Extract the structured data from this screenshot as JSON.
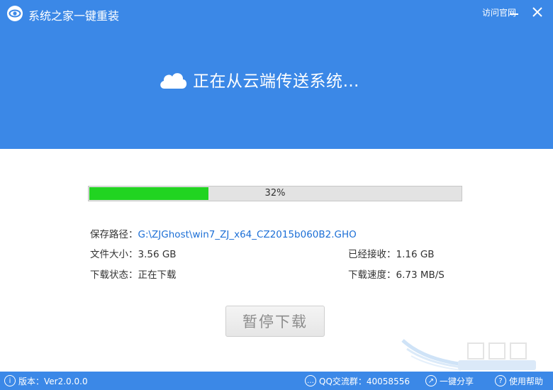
{
  "title_bar": {
    "app_title": "系统之家一键重装",
    "visit_link": "访问官网",
    "icons": [
      "app-logo-icon",
      "minimize-icon",
      "close-icon"
    ]
  },
  "status": {
    "text": "正在从云端传送系统…",
    "icon": "cloud-icon"
  },
  "progress": {
    "percent_text": "32%",
    "fraction": 0.32,
    "fill_color": "#21d421"
  },
  "info": {
    "path_label": "保存路径：",
    "path_value": "G:\\ZJGhost\\win7_ZJ_x64_CZ2015b060B2.GHO",
    "size_label": "文件大小：",
    "size_value": "3.56 GB",
    "received_label": "已经接收：",
    "received_value": "1.16 GB",
    "state_label": "下载状态：",
    "state_value": "正在下载",
    "speed_label": "下载速度：",
    "speed_value": "6.73 MB/S"
  },
  "buttons": {
    "pause": "暂停下载"
  },
  "footer": {
    "version": "版本：Ver2.0.0.0",
    "qq_group": "QQ交流群：40058556",
    "share": "一键分享",
    "help": "使用帮助"
  },
  "colors": {
    "header_blue": "#3b88e7",
    "link_blue": "#1c6fd6"
  }
}
